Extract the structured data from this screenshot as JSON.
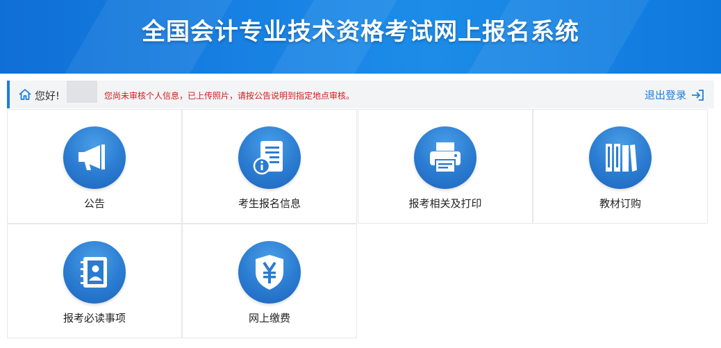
{
  "header": {
    "title": "全国会计专业技术资格考试网上报名系统"
  },
  "infobar": {
    "greeting": "您好!",
    "notice": "您尚未审核个人信息，已上传照片，请按公告说明到指定地点审核。",
    "logout_label": "退出登录"
  },
  "colors": {
    "primary": "#1a7fd9",
    "notice": "#d41b1b",
    "banner": "#1a86e6"
  },
  "menu": {
    "items": [
      {
        "label": "公告",
        "icon": "megaphone-icon"
      },
      {
        "label": "考生报名信息",
        "icon": "info-document-icon"
      },
      {
        "label": "报考相关及打印",
        "icon": "printer-icon"
      },
      {
        "label": "教材订购",
        "icon": "books-icon"
      },
      {
        "label": "报考必读事项",
        "icon": "contact-book-icon"
      },
      {
        "label": "网上缴费",
        "icon": "yuan-shield-icon"
      }
    ]
  }
}
